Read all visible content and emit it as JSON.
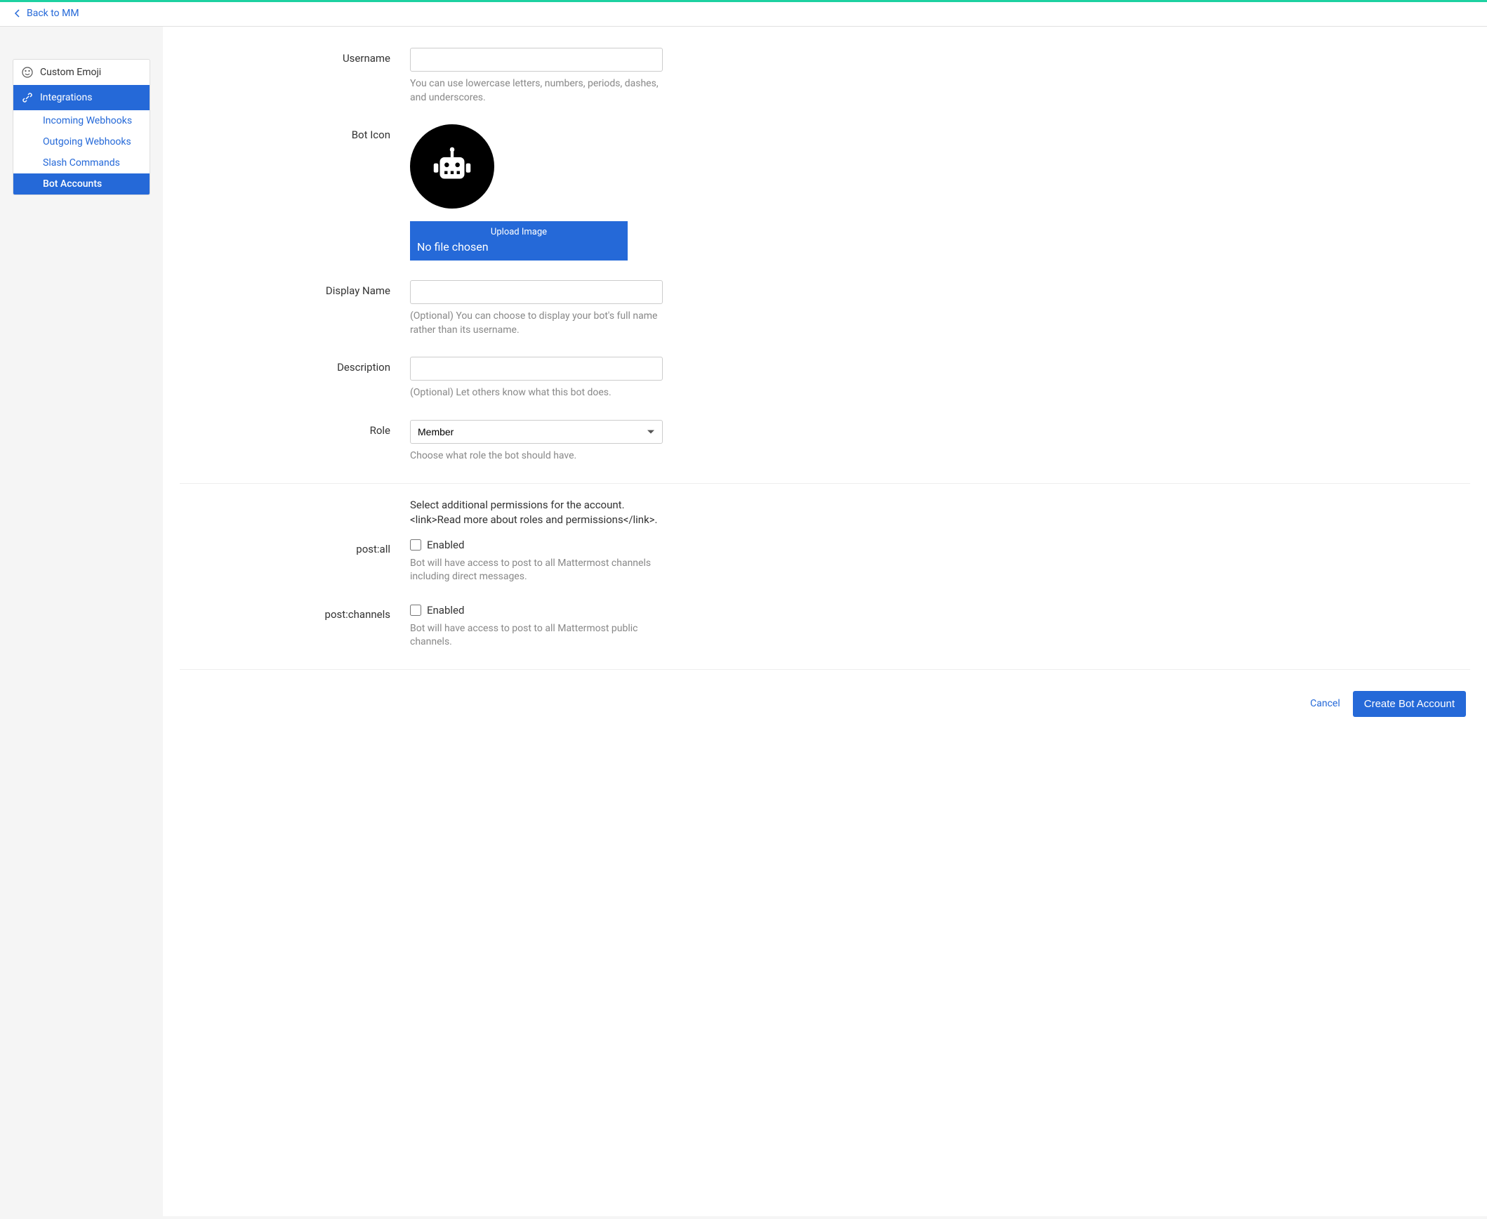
{
  "topbar": {
    "back_label": "Back to MM"
  },
  "sidebar": {
    "custom_emoji": "Custom Emoji",
    "integrations": "Integrations",
    "subitems": [
      {
        "label": "Incoming Webhooks"
      },
      {
        "label": "Outgoing Webhooks"
      },
      {
        "label": "Slash Commands"
      },
      {
        "label": "Bot Accounts"
      }
    ]
  },
  "form": {
    "username": {
      "label": "Username",
      "value": "",
      "help": "You can use lowercase letters, numbers, periods, dashes, and underscores."
    },
    "bot_icon": {
      "label": "Bot Icon",
      "upload_label": "Upload Image",
      "file_status": "No file chosen"
    },
    "display_name": {
      "label": "Display Name",
      "value": "",
      "help": "(Optional) You can choose to display your bot's full name rather than its username."
    },
    "description": {
      "label": "Description",
      "value": "",
      "help": "(Optional) Let others know what this bot does."
    },
    "role": {
      "label": "Role",
      "value": "Member",
      "help": "Choose what role the bot should have."
    },
    "permissions": {
      "intro": "Select additional permissions for the account. <link>Read more about roles and permissions</link>.",
      "post_all": {
        "label": "post:all",
        "checkbox_label": "Enabled",
        "help": "Bot will have access to post to all Mattermost channels including direct messages."
      },
      "post_channels": {
        "label": "post:channels",
        "checkbox_label": "Enabled",
        "help": "Bot will have access to post to all Mattermost public channels."
      }
    }
  },
  "actions": {
    "cancel": "Cancel",
    "create": "Create Bot Account"
  }
}
